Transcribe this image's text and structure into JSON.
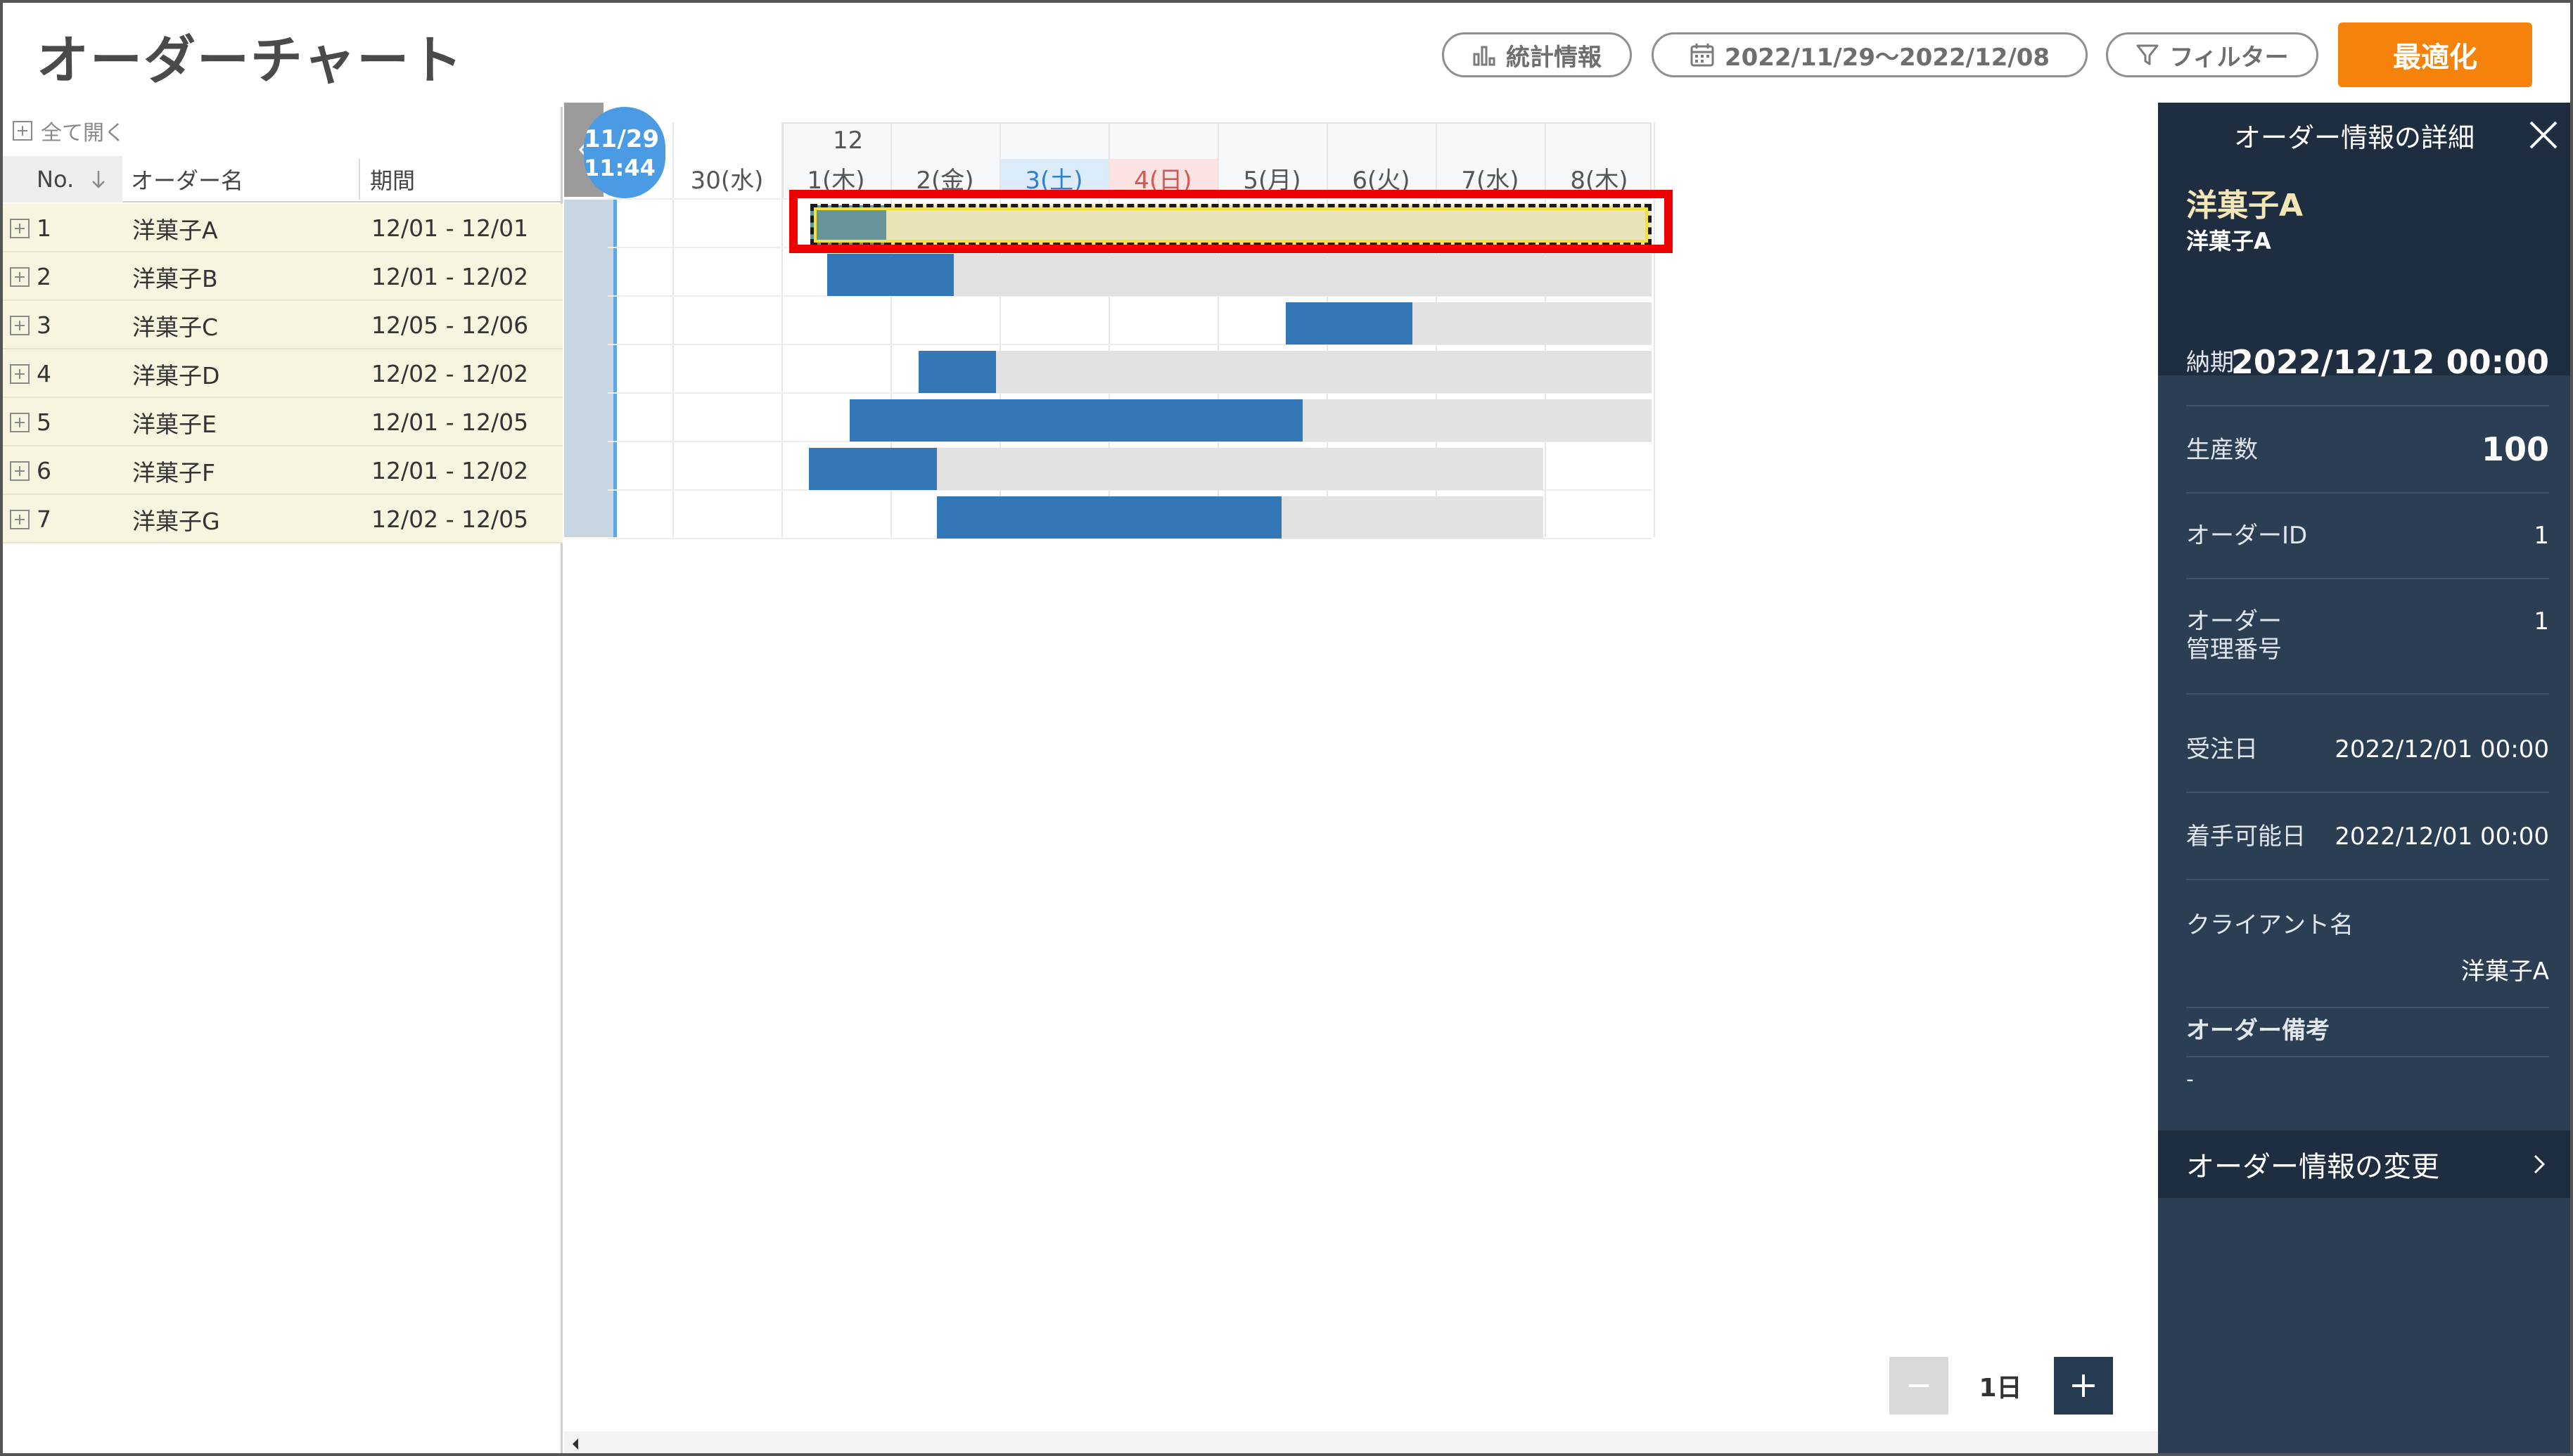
{
  "header": {
    "title": "オーダーチャート",
    "stats_label": "統計情報",
    "date_range": "2022/11/29〜2022/12/08",
    "filter_label": "フィルター",
    "optimize_label": "最適化"
  },
  "table": {
    "expand_all": "全て開く",
    "columns": {
      "no": "No.",
      "name": "オーダー名",
      "period": "期間"
    },
    "rows": [
      {
        "no": "1",
        "name": "洋菓子A",
        "period": "12/01 - 12/01"
      },
      {
        "no": "2",
        "name": "洋菓子B",
        "period": "12/01 - 12/02"
      },
      {
        "no": "3",
        "name": "洋菓子C",
        "period": "12/05 - 12/06"
      },
      {
        "no": "4",
        "name": "洋菓子D",
        "period": "12/02 - 12/02"
      },
      {
        "no": "5",
        "name": "洋菓子E",
        "period": "12/01 - 12/05"
      },
      {
        "no": "6",
        "name": "洋菓子F",
        "period": "12/01 - 12/02"
      },
      {
        "no": "7",
        "name": "洋菓子G",
        "period": "12/02 - 12/05"
      }
    ]
  },
  "timeline": {
    "current_marker": {
      "date": "11/29",
      "time": "11:44"
    },
    "month_label": "12",
    "days": [
      "30(水)",
      "1(木)",
      "2(金)",
      "3(土)",
      "4(日)",
      "5(月)",
      "6(火)",
      "7(水)",
      "8(木)"
    ],
    "saturday_color": "#2f80d1",
    "sunday_color": "#d9534f",
    "saturday_bg": "#dcecfb",
    "sunday_bg": "#fbe3e3",
    "bar_color": "#3377b7",
    "available_color": "#e2e2e2",
    "zoom_level": "1日"
  },
  "detail_panel": {
    "title": "オーダー情報の詳細",
    "order_name": "洋菓子A",
    "order_sub": "洋菓子A",
    "fields": [
      {
        "label": "納期",
        "value": "2022/12/12 00:00"
      },
      {
        "label": "生産数",
        "value": "100"
      },
      {
        "label": "オーダーID",
        "value": "1"
      },
      {
        "label": "オーダー\n管理番号",
        "value": "1"
      },
      {
        "label": "受注日",
        "value": "2022/12/01 00:00"
      },
      {
        "label": "着手可能日",
        "value": "2022/12/01 00:00"
      },
      {
        "label": "クライアント名",
        "value": "洋菓子A"
      }
    ],
    "memo_label": "オーダー備考",
    "memo_value": "-",
    "edit_label": "オーダー情報の変更"
  },
  "colors": {
    "accent": "#f5820b",
    "panel_bg": "#2c3e54",
    "panel_dark": "#1e2d3f",
    "row_bg": "#f7f5df",
    "highlight": "#ee0000"
  }
}
